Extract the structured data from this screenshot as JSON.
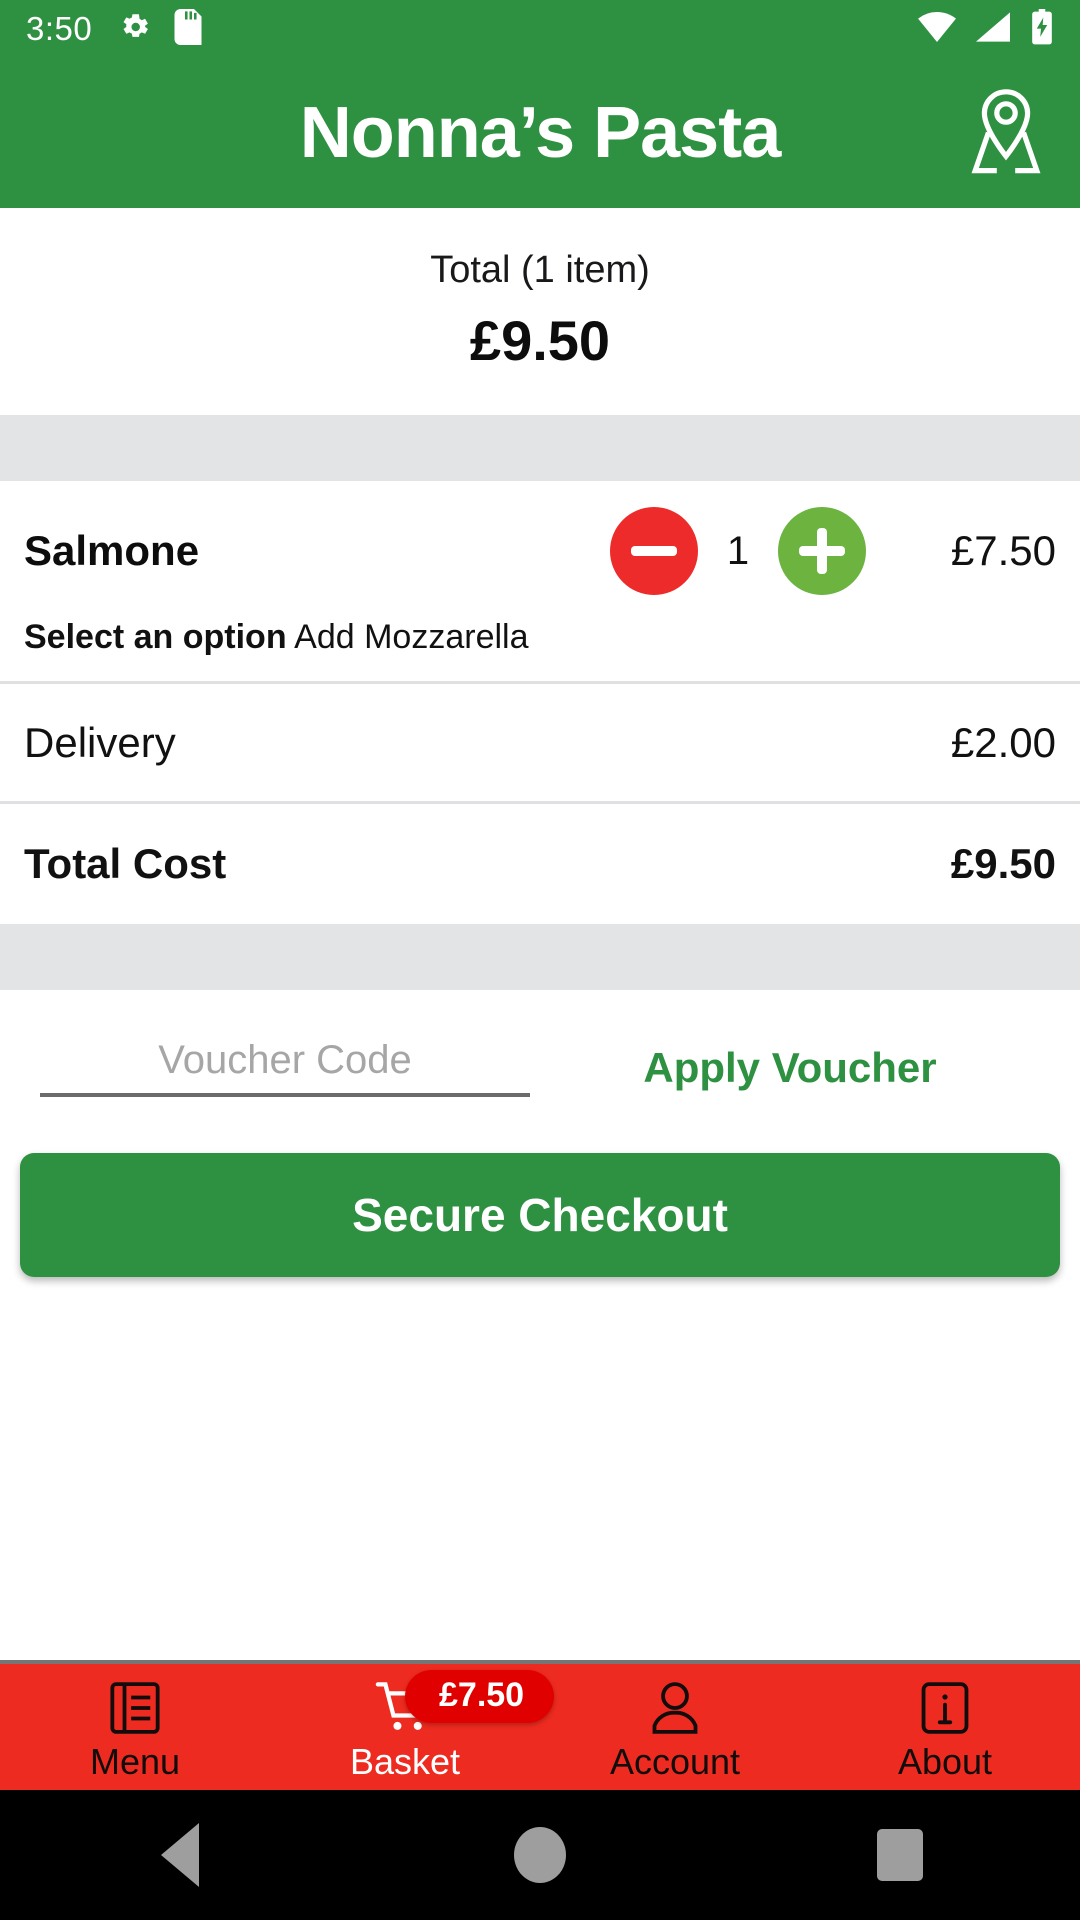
{
  "status_bar": {
    "time": "3:50",
    "left_icons": [
      "gear-icon",
      "sd-card-icon"
    ],
    "right_icons": [
      "wifi-icon",
      "cellular-signal-icon",
      "battery-charging-icon"
    ]
  },
  "app_bar": {
    "title": "Nonna’s Pasta",
    "action_icon": "map-location-pin-icon",
    "background_color": "#2E9142"
  },
  "order_summary": {
    "label": "Total (1 item)",
    "amount": "£9.50"
  },
  "basket": {
    "items": [
      {
        "name": "Salmone",
        "quantity": "1",
        "price": "£7.50",
        "option_label": "Select an option",
        "option_value": "Add Mozzarella",
        "decrement_icon": "minus-circle-icon",
        "increment_icon": "plus-circle-icon"
      }
    ],
    "lines": [
      {
        "label": "Delivery",
        "value": "£2.00",
        "emphasis": false
      },
      {
        "label": "Total Cost",
        "value": "£9.50",
        "emphasis": true
      }
    ]
  },
  "voucher": {
    "placeholder": "Voucher Code",
    "value": "",
    "apply_label": "Apply Voucher"
  },
  "checkout": {
    "label": "Secure Checkout"
  },
  "bottom_nav": {
    "background_color": "#EE2B20",
    "badge": {
      "text": "£7.50",
      "color": "#E00000"
    },
    "items": [
      {
        "label": "Menu",
        "icon": "menu-book-icon",
        "active": false
      },
      {
        "label": "Basket",
        "icon": "shopping-cart-icon",
        "active": true
      },
      {
        "label": "Account",
        "icon": "person-icon",
        "active": false
      },
      {
        "label": "About",
        "icon": "info-icon",
        "active": false
      }
    ]
  },
  "system_nav": {
    "buttons": [
      "back-triangle-icon",
      "home-circle-icon",
      "recents-square-icon"
    ]
  },
  "colors": {
    "brand_green": "#2E9142",
    "accent_red": "#EE2B2B",
    "accent_green": "#6CB33F",
    "nav_red": "#EE2B20",
    "band_grey": "#E3E4E6"
  }
}
